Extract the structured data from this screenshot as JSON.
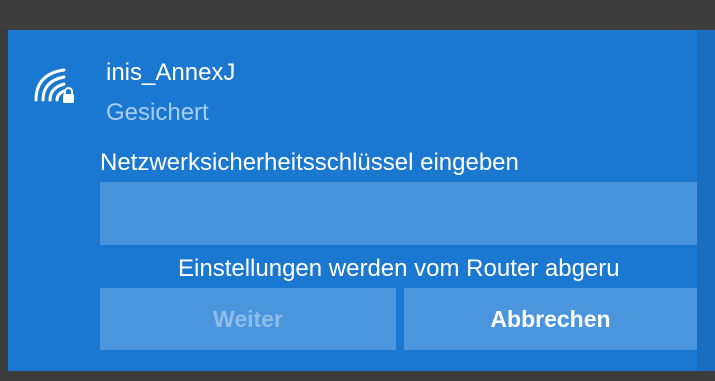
{
  "network": {
    "ssid": "inis_AnnexJ",
    "security_status": "Gesichert",
    "icon": "wifi-secured-icon"
  },
  "key_prompt": {
    "label": "Netzwerksicherheitsschlüssel eingeben",
    "value": "",
    "placeholder": ""
  },
  "router_note": "Einstellungen werden vom Router abgeru",
  "buttons": {
    "next_label": "Weiter",
    "cancel_label": "Abbrechen"
  },
  "colors": {
    "panel": "#1b78d0",
    "input": "#4793dc",
    "button": "#4a95dd",
    "secondary_text": "#a9cdf2",
    "disabled_text": "#8fbde9"
  }
}
